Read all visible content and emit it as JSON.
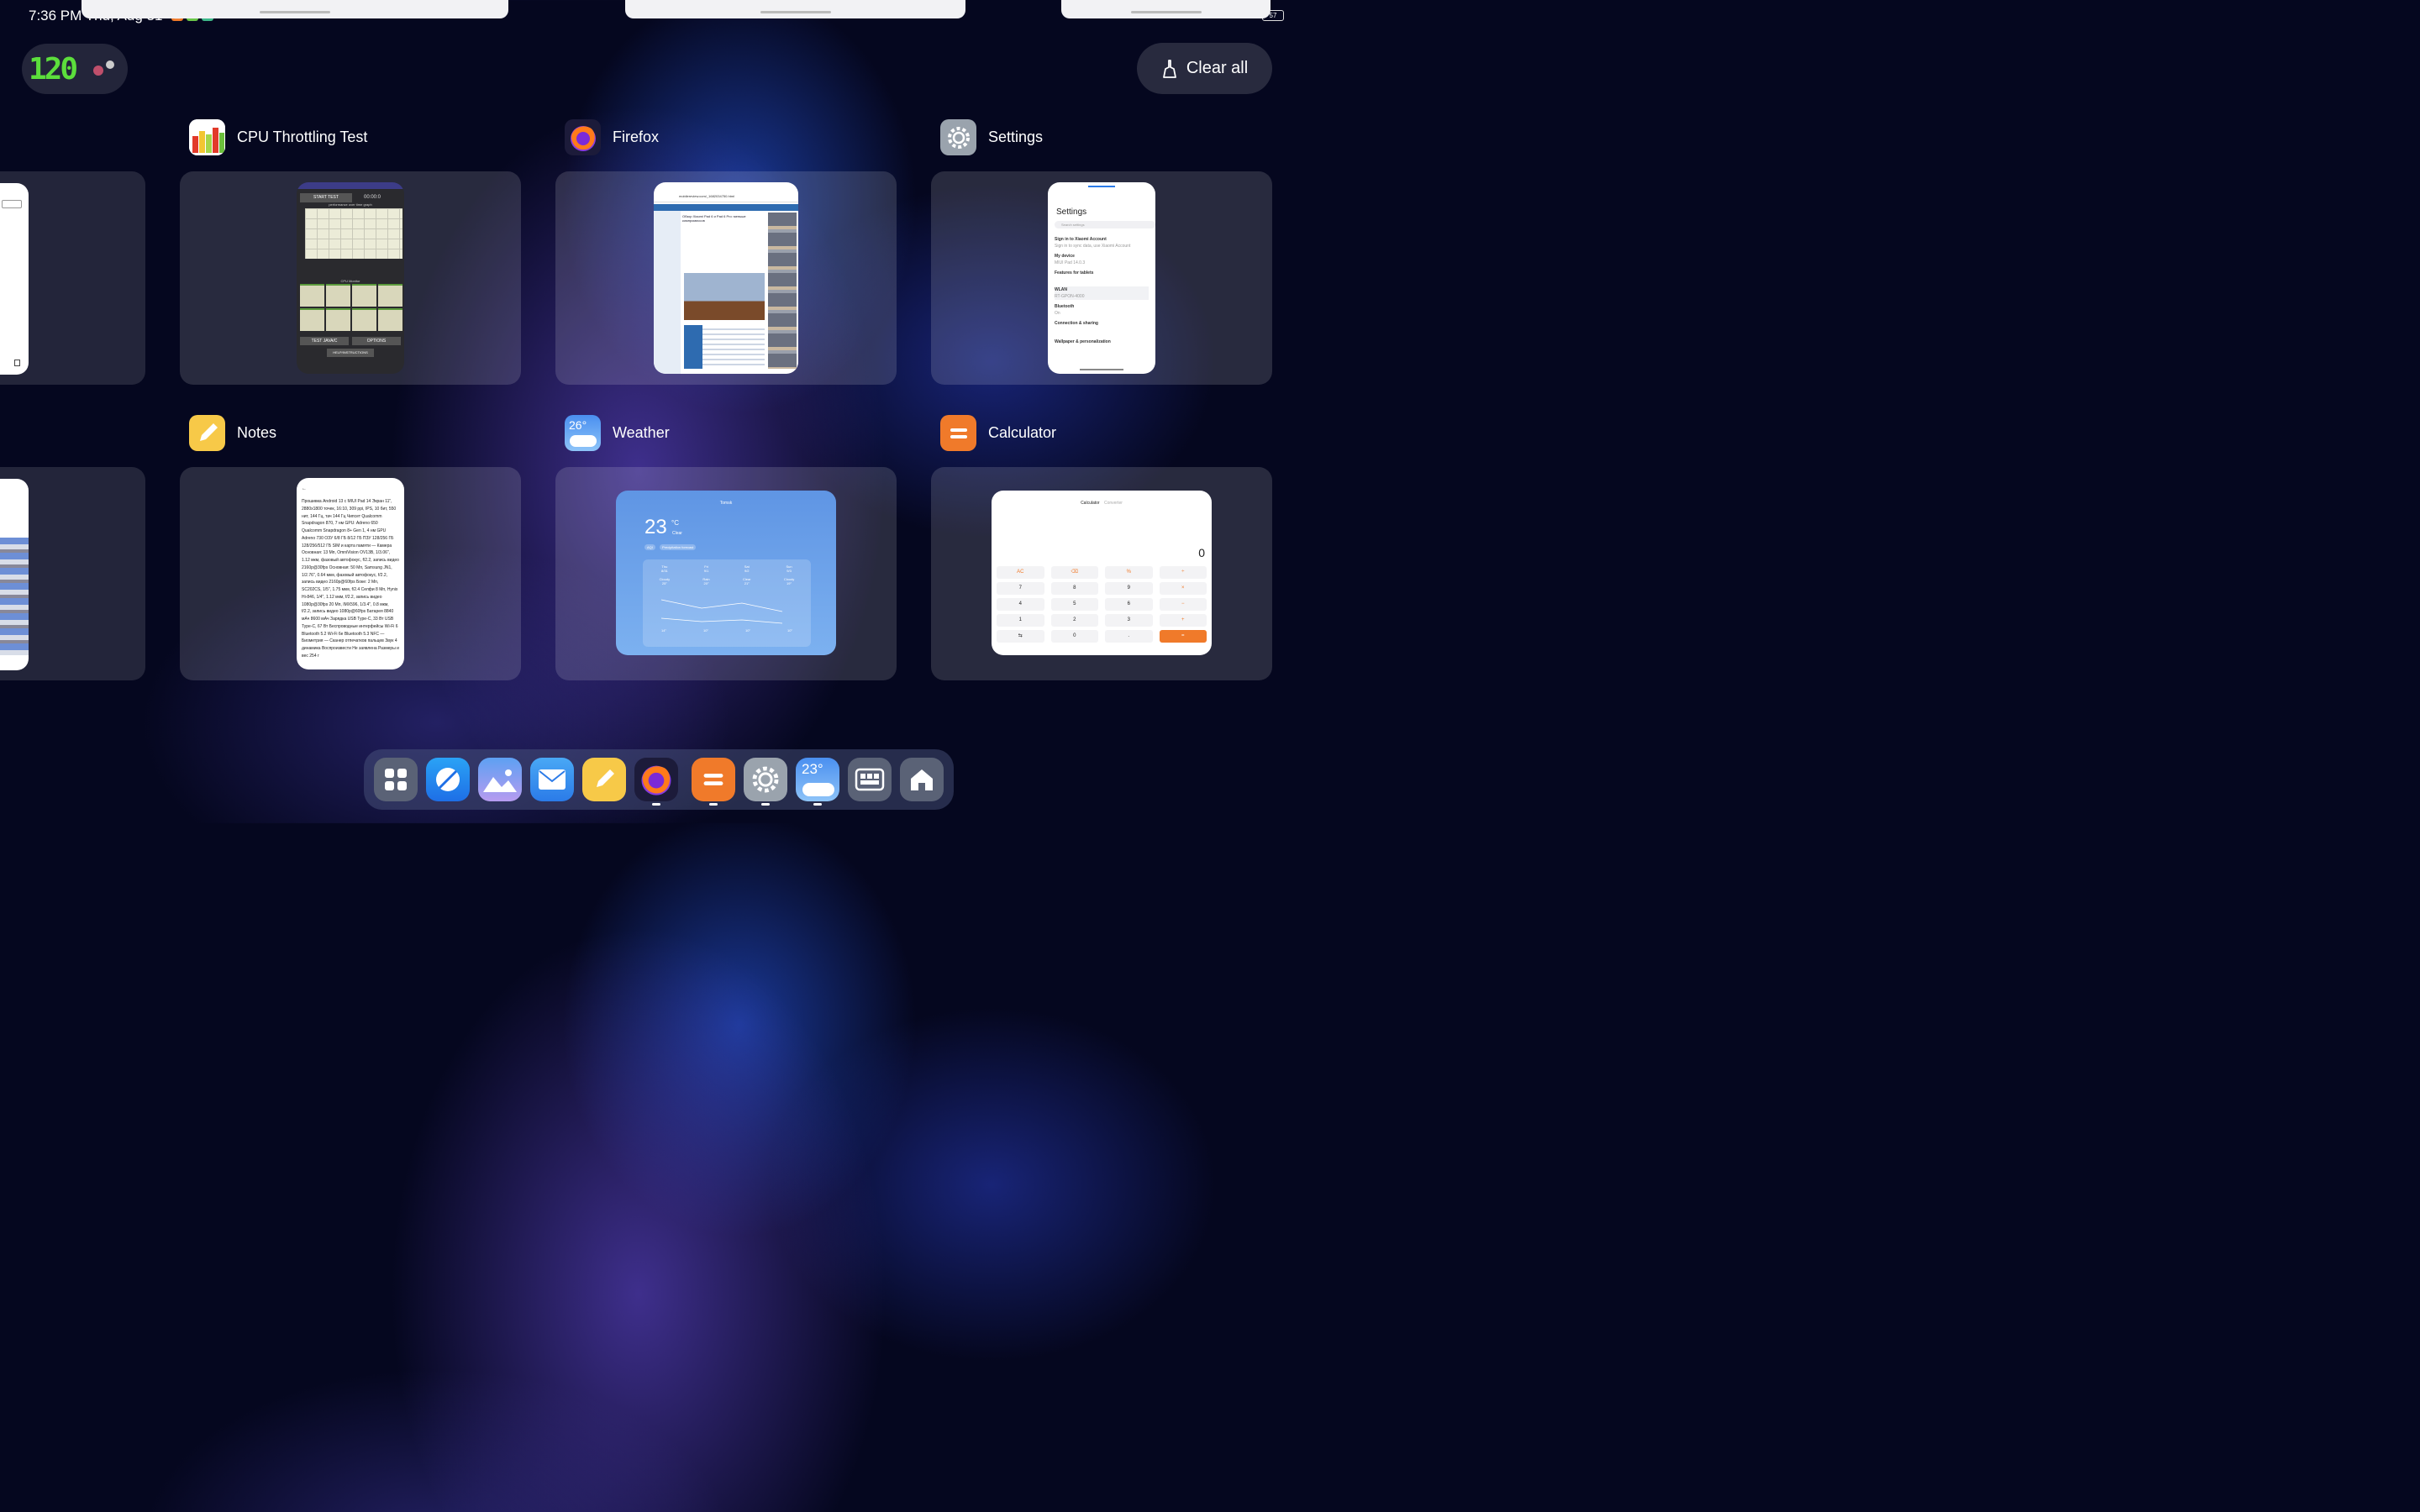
{
  "status_bar": {
    "time": "7:36 PM Thu, Aug 31",
    "battery": "57"
  },
  "fps_overlay": {
    "value": "120"
  },
  "clear_all": {
    "label": "Clear all"
  },
  "apps": [
    {
      "name": "CPU Throttling Test"
    },
    {
      "name": "Firefox"
    },
    {
      "name": "Settings"
    },
    {
      "name": "Notes"
    },
    {
      "name": "Weather"
    },
    {
      "name": "Calculator"
    }
  ],
  "cpu_test": {
    "start_label": "START TEST",
    "timer": "00:00:0",
    "graph_title": "performance over time graph",
    "monitor_title": "CPU Monitor",
    "test_java": "TEST JAVA/C",
    "options": "OPTIONS",
    "help": "HELP/INSTRUCTIONS"
  },
  "firefox": {
    "url": "mobilereview.com/_1682034750.html",
    "headline": "Обзор Xiaomi Pad 6 и Pad 6 Pro: меньше компромиссов"
  },
  "settings_preview": {
    "title": "Settings",
    "search": "Search settings",
    "items": [
      {
        "label": "Sign in to Xiaomi Account",
        "sub": "Sign in to sync data, use Xiaomi Account"
      },
      {
        "label": "My device",
        "sub": "MIUI Pad 14.0.3"
      },
      {
        "label": "Features for tablets",
        "sub": ""
      },
      {
        "label": "WLAN",
        "sub": "RT-GPON-4000"
      },
      {
        "label": "Bluetooth",
        "sub": "On"
      },
      {
        "label": "Connection & sharing",
        "sub": ""
      },
      {
        "label": "Wallpaper & personalization",
        "sub": ""
      }
    ]
  },
  "notes_preview": {
    "text": "Прошивка Android 13 с MIUI Pad 14 Экран 11\", 2880x1800 точек, 16:10, 309 ppi, IPS, 10 бит, 550 нит, 144 Гц, тач 144 Гц Чипсет Qualcomm Snapdragon 870, 7 нм GPU: Adreno 650 Qualcomm Snapdragon 8+ Gen 1, 4 нм GPU Adreno 730 ОЗУ 6/8 ГБ 8/12 ГБ ПЗУ 128/256 ГБ 128/256/512 ГБ SIM и карта памяти — Камера Основная: 13 Мп, OmniVision OV13B, 1/3.06\", 1.12 мкм, фазовый автофокус, f/2.2, запись видео 2160p@30fps Основная: 50 Мп, Samsung JN1, 1/2.76\", 0.64 мкм, фазовый автофокус, f/2.2, запись видео 2160p@60fps Боке: 2 Мп, SC202CS, 1/5\", 1.75 мкм, f/2.4 Селфи 8 Мп, Hynix Hi-846, 1/4\", 1.12 мкм, f/2.2, запись видео 1080p@30fps 20 Мп, IMX596, 1/3.4\", 0.8 мкм, f/2.2, запись видео 1080p@60fps Батарея 8840 мАч 8600 мАч Зарядка USB Type-C, 33 Вт USB Type-C, 67 Вт Беспроводные интерфейсы Wi-Fi 6 Bluetooth 5.2 Wi-Fi 6e Bluetooth 5.3 NFC — Биометрия — Сканер отпечатков пальцев Звук 4 динамика Воспроизвести Не заявлена Размеры и вес 254 г"
  },
  "weather_preview": {
    "city": "Tomsk",
    "temp": "23",
    "unit": "°C",
    "condition": "Clear",
    "aqi": "AQI",
    "forecast_label": "Precipitation forecast",
    "days": [
      {
        "day": "Thu",
        "date": "8/31",
        "cond": "Cloudy",
        "high": "25°",
        "low": "14°"
      },
      {
        "day": "Fri",
        "date": "9/1",
        "cond": "Rain",
        "high": "20°",
        "low": "10°"
      },
      {
        "day": "Sat",
        "date": "9/2",
        "cond": "Clear",
        "high": "21°",
        "low": "10°"
      },
      {
        "day": "Sun",
        "date": "9/3",
        "cond": "Cloudy",
        "high": "19°",
        "low": "10°"
      }
    ],
    "icon_temp": "26°"
  },
  "calculator_preview": {
    "tab_calc": "Calculator",
    "tab_conv": "Converter",
    "display": "0",
    "keys": [
      [
        "AC",
        "⌫",
        "%",
        "÷"
      ],
      [
        "7",
        "8",
        "9",
        "×"
      ],
      [
        "4",
        "5",
        "6",
        "−"
      ],
      [
        "1",
        "2",
        "3",
        "+"
      ],
      [
        "⇆",
        "0",
        ".",
        "="
      ]
    ]
  },
  "dock": {
    "weather_temp": "23°",
    "items": [
      "app-drawer",
      "browser",
      "gallery",
      "mail",
      "notes",
      "firefox",
      "calculator",
      "settings",
      "weather",
      "recents",
      "home"
    ]
  },
  "colors": {
    "accent_orange": "#f07a2a",
    "fps_green": "#5cde3c",
    "background": "#05071f"
  }
}
